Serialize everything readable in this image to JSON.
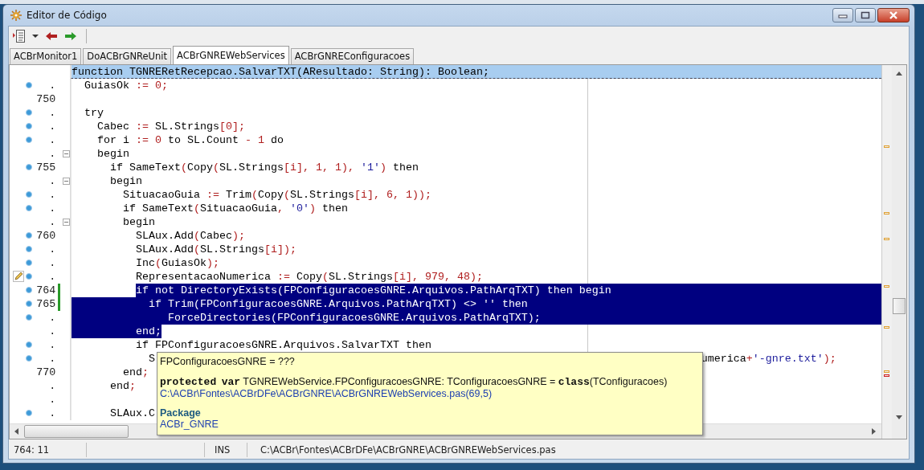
{
  "window": {
    "title": "Editor de Código"
  },
  "tabs": [
    {
      "label": "ACBrMonitor1",
      "selected": false
    },
    {
      "label": "DoACBrGNReUnit",
      "selected": false
    },
    {
      "label": "ACBrGNREWebServices",
      "selected": true
    },
    {
      "label": "ACBrGNREConfiguracoes",
      "selected": false
    }
  ],
  "editor": {
    "lines": [
      {
        "kind": "current",
        "dot": false,
        "fold": false,
        "modified": false,
        "segments": [
          {
            "kind": "code",
            "text": "function TGNRERetRecepcao.SalvarTXT(AResultado: String): Boolean;"
          }
        ]
      },
      {
        "kind": "plain",
        "number": ".",
        "dot": true,
        "fold": false,
        "modified": false,
        "segments": [
          {
            "kind": "code",
            "text": "  GuiasOk "
          },
          {
            "kind": "symbol",
            "text": ":= 0;"
          }
        ]
      },
      {
        "kind": "plain",
        "number": "750",
        "dot": false,
        "fold": false,
        "modified": false
      },
      {
        "kind": "plain",
        "number": ".",
        "dot": true,
        "fold": false,
        "modified": false,
        "segments": [
          {
            "kind": "code",
            "text": "  try"
          }
        ]
      },
      {
        "kind": "plain",
        "number": ".",
        "dot": true,
        "fold": false,
        "modified": false,
        "segments": [
          {
            "kind": "code",
            "text": "    Cabec "
          },
          {
            "kind": "symbol",
            "text": ":="
          },
          {
            "kind": "code",
            "text": " SL.Strings"
          },
          {
            "kind": "symbol",
            "text": "[0];"
          }
        ]
      },
      {
        "kind": "plain",
        "number": ".",
        "dot": true,
        "fold": false,
        "modified": false,
        "segments": [
          {
            "kind": "code",
            "text": "    for i "
          },
          {
            "kind": "symbol",
            "text": ":= 0"
          },
          {
            "kind": "code",
            "text": " to SL.Count "
          },
          {
            "kind": "symbol",
            "text": "- 1"
          },
          {
            "kind": "code",
            "text": " do"
          }
        ]
      },
      {
        "kind": "plain",
        "number": ".",
        "dot": false,
        "fold": true,
        "modified": false,
        "segments": [
          {
            "kind": "code",
            "text": "    begin"
          }
        ]
      },
      {
        "kind": "plain",
        "number": "755",
        "dot": true,
        "fold": false,
        "modified": false,
        "segments": [
          {
            "kind": "code",
            "text": "      if SameText"
          },
          {
            "kind": "symbol",
            "text": "("
          },
          {
            "kind": "code",
            "text": "Copy"
          },
          {
            "kind": "symbol",
            "text": "("
          },
          {
            "kind": "code",
            "text": "SL.Strings"
          },
          {
            "kind": "symbol",
            "text": "[i], 1, 1), "
          },
          {
            "kind": "string",
            "text": "'1'"
          },
          {
            "kind": "symbol",
            "text": ")"
          },
          {
            "kind": "code",
            "text": " then"
          }
        ]
      },
      {
        "kind": "plain",
        "number": ".",
        "dot": false,
        "fold": true,
        "modified": false,
        "segments": [
          {
            "kind": "code",
            "text": "      begin"
          }
        ]
      },
      {
        "kind": "plain",
        "number": ".",
        "dot": true,
        "fold": false,
        "modified": false,
        "segments": [
          {
            "kind": "code",
            "text": "        SituacaoGuia "
          },
          {
            "kind": "symbol",
            "text": ":="
          },
          {
            "kind": "code",
            "text": " Trim"
          },
          {
            "kind": "symbol",
            "text": "("
          },
          {
            "kind": "code",
            "text": "Copy"
          },
          {
            "kind": "symbol",
            "text": "("
          },
          {
            "kind": "code",
            "text": "SL.Strings"
          },
          {
            "kind": "symbol",
            "text": "[i], 6, 1));"
          }
        ]
      },
      {
        "kind": "plain",
        "number": ".",
        "dot": true,
        "fold": false,
        "modified": false,
        "segments": [
          {
            "kind": "code",
            "text": "        if SameText"
          },
          {
            "kind": "symbol",
            "text": "("
          },
          {
            "kind": "code",
            "text": "SituacaoGuia"
          },
          {
            "kind": "symbol",
            "text": ", "
          },
          {
            "kind": "string",
            "text": "'0'"
          },
          {
            "kind": "symbol",
            "text": ")"
          },
          {
            "kind": "code",
            "text": " then"
          }
        ]
      },
      {
        "kind": "plain",
        "number": ".",
        "dot": false,
        "fold": true,
        "modified": false,
        "segments": [
          {
            "kind": "code",
            "text": "        begin"
          }
        ]
      },
      {
        "kind": "plain",
        "number": "760",
        "dot": true,
        "fold": false,
        "modified": false,
        "segments": [
          {
            "kind": "code",
            "text": "          SLAux.Add"
          },
          {
            "kind": "symbol",
            "text": "("
          },
          {
            "kind": "code",
            "text": "Cabec"
          },
          {
            "kind": "symbol",
            "text": ");"
          }
        ]
      },
      {
        "kind": "plain",
        "number": ".",
        "dot": true,
        "fold": false,
        "modified": false,
        "segments": [
          {
            "kind": "code",
            "text": "          SLAux.Add"
          },
          {
            "kind": "symbol",
            "text": "("
          },
          {
            "kind": "code",
            "text": "SL.Strings"
          },
          {
            "kind": "symbol",
            "text": "[i]);"
          }
        ]
      },
      {
        "kind": "plain",
        "number": ".",
        "dot": true,
        "fold": false,
        "modified": false,
        "segments": [
          {
            "kind": "code",
            "text": "          Inc"
          },
          {
            "kind": "symbol",
            "text": "("
          },
          {
            "kind": "code",
            "text": "GuiasOk"
          },
          {
            "kind": "symbol",
            "text": ");"
          }
        ]
      },
      {
        "kind": "plain",
        "number": ".",
        "dot": true,
        "fold": false,
        "modified": false,
        "edit_marker": true,
        "segments": [
          {
            "kind": "code",
            "text": "          RepresentacaoNumerica "
          },
          {
            "kind": "symbol",
            "text": ":="
          },
          {
            "kind": "code",
            "text": " Copy"
          },
          {
            "kind": "symbol",
            "text": "("
          },
          {
            "kind": "code",
            "text": "SL.Strings"
          },
          {
            "kind": "symbol",
            "text": "[i], 979, 48);"
          }
        ]
      },
      {
        "kind": "selection-start",
        "number": "764",
        "dot": true,
        "fold": false,
        "modified": true,
        "segments": [
          {
            "kind": "selection",
            "text": "          if not DirectoryExists(FPConfiguracoesGNRE.Arquivos.PathArqTXT) then begin"
          }
        ]
      },
      {
        "kind": "selected",
        "number": "765",
        "dot": true,
        "fold": false,
        "modified": true,
        "segments": [
          {
            "kind": "selection",
            "text": "            if Trim(FPConfiguracoesGNRE.Arquivos.PathArqTXT) <> '' then"
          }
        ]
      },
      {
        "kind": "selected",
        "number": ".",
        "dot": true,
        "fold": false,
        "modified": false,
        "segments": [
          {
            "kind": "selection",
            "text": "               ForceDirectories(FPConfiguracoesGNRE.Arquivos.PathArqTXT);"
          }
        ]
      },
      {
        "kind": "plain",
        "number": ".",
        "dot": false,
        "fold": false,
        "modified": false,
        "segments": [
          {
            "kind": "selection",
            "text": "          end;"
          }
        ]
      },
      {
        "kind": "plain",
        "number": ".",
        "dot": true,
        "fold": false,
        "modified": false,
        "segments": [
          {
            "kind": "code",
            "text": "          if FPConfiguracoesGNRE.Arquivos.SalvarTXT then"
          }
        ]
      },
      {
        "kind": "plain",
        "number": ".",
        "dot": true,
        "fold": false,
        "modified": false,
        "segments": [
          {
            "kind": "code",
            "text": "            S"
          }
        ],
        "tail": [
          {
            "kind": "code",
            "text": "umerica"
          },
          {
            "kind": "symbol",
            "text": "+"
          },
          {
            "kind": "string",
            "text": "'-gnre.txt'"
          },
          {
            "kind": "symbol",
            "text": ");"
          }
        ]
      },
      {
        "kind": "plain",
        "number": "770",
        "dot": false,
        "fold": false,
        "modified": false,
        "segments": [
          {
            "kind": "code",
            "text": "        end"
          },
          {
            "kind": "symbol",
            "text": ";"
          }
        ]
      },
      {
        "kind": "plain",
        "number": ".",
        "dot": false,
        "fold": false,
        "modified": false,
        "segments": [
          {
            "kind": "code",
            "text": "      end"
          },
          {
            "kind": "symbol",
            "text": ";"
          }
        ]
      },
      {
        "kind": "plain",
        "number": ".",
        "dot": false,
        "fold": false,
        "modified": false
      },
      {
        "kind": "plain",
        "number": ".",
        "dot": true,
        "fold": false,
        "modified": false,
        "segments": [
          {
            "kind": "code",
            "text": "      SLAux.C"
          }
        ]
      }
    ]
  },
  "tooltip": {
    "title": "FPConfiguracoesGNRE = ???",
    "declaration": [
      {
        "kind": "keyword",
        "text": "protected"
      },
      {
        "kind": "keyword",
        "text": "var"
      },
      {
        "kind": "plain",
        "text": " TGNREWebService.FPConfiguracoesGNRE: TConfiguracoesGNRE = "
      },
      {
        "kind": "keyword",
        "text": "class"
      },
      {
        "kind": "plain",
        "text": "(TConfiguracoes)"
      }
    ],
    "location": "C:\\ACBr\\Fontes\\ACBrDFe\\ACBrGNRE\\ACBrGNREWebServices.pas(69,5)",
    "package_heading": "Package",
    "package": "ACBr_GNRE"
  },
  "status_bar": {
    "position": "764: 11",
    "mode": "INS",
    "file": "C:\\ACBr\\Fontes\\ACBrDFe\\ACBrGNRE\\ACBrGNREWebServices.pas"
  }
}
